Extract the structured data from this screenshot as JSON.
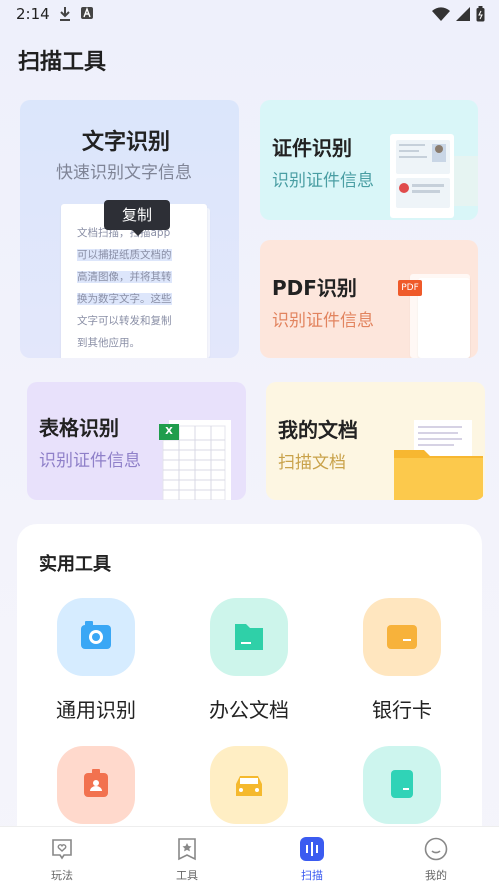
{
  "status_bar": {
    "time": "2:14"
  },
  "header": {
    "title": "扫描工具"
  },
  "cards": {
    "text": {
      "title": "文字识别",
      "subtitle": "快速识别文字信息",
      "sample_lines": [
        "文档扫描，扫描app",
        "可以捕捉纸质文档的",
        "高清图像，并将其转",
        "换为数字文字。这些",
        "文字可以转发和复制",
        "到其他应用。"
      ],
      "copy_label": "复制"
    },
    "cert": {
      "title": "证件识别",
      "subtitle": "识别证件信息"
    },
    "pdf": {
      "title": "PDF识别",
      "subtitle": "识别证件信息",
      "badge": "PDF"
    },
    "table": {
      "title": "表格识别",
      "subtitle": "识别证件信息",
      "badge": "X"
    },
    "docs": {
      "title": "我的文档",
      "subtitle": "扫描文档"
    }
  },
  "tools": {
    "title": "实用工具",
    "items": [
      {
        "label": "通用识别",
        "icon": "camera-icon"
      },
      {
        "label": "办公文档",
        "icon": "folder-icon"
      },
      {
        "label": "银行卡",
        "icon": "wallet-icon"
      },
      {
        "label": "",
        "icon": "id-badge-icon"
      },
      {
        "label": "",
        "icon": "car-icon"
      },
      {
        "label": "",
        "icon": "card-icon"
      }
    ]
  },
  "tabbar": {
    "items": [
      {
        "label": "玩法",
        "icon": "heart-message-icon"
      },
      {
        "label": "工具",
        "icon": "star-bookmark-icon"
      },
      {
        "label": "扫描",
        "icon": "scan-icon"
      },
      {
        "label": "我的",
        "icon": "smile-icon"
      }
    ],
    "active_index": 2,
    "active_color": "#3b5bf0"
  },
  "colors": {
    "text_sub": "#7f8496",
    "cert_sub": "#4a9ea3",
    "pdf_sub": "#e2845f",
    "table_sub": "#8f80c9",
    "docs_sub": "#c9a24a"
  }
}
